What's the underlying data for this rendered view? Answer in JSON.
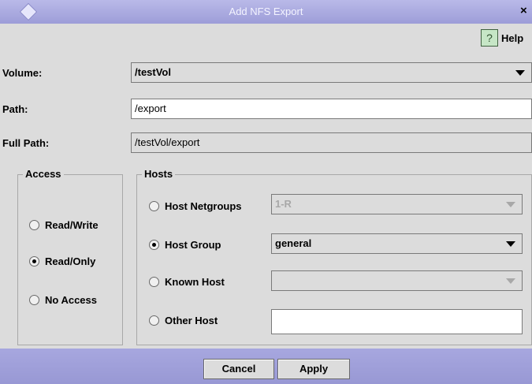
{
  "window": {
    "title": "Add NFS Export",
    "close_glyph": "×"
  },
  "toolbar": {
    "help_icon": "?",
    "help_label": "Help"
  },
  "form": {
    "volume": {
      "label": "Volume:",
      "value": "/testVol"
    },
    "path": {
      "label": "Path:",
      "value": "/export"
    },
    "full_path": {
      "label": "Full Path:",
      "value": "/testVol/export"
    }
  },
  "access": {
    "title": "Access",
    "options": [
      {
        "label": "Read/Write",
        "selected": false
      },
      {
        "label": "Read/Only",
        "selected": true
      },
      {
        "label": "No Access",
        "selected": false
      }
    ]
  },
  "hosts": {
    "title": "Hosts",
    "netgroups": {
      "label": "Host Netgroups",
      "value": "1-R",
      "selected": false,
      "enabled": false
    },
    "host_group": {
      "label": "Host Group",
      "value": "general",
      "selected": true,
      "enabled": true
    },
    "known_host": {
      "label": "Known Host",
      "value": "",
      "selected": false,
      "enabled": false
    },
    "other_host": {
      "label": "Other Host",
      "value": "",
      "selected": false
    }
  },
  "buttons": {
    "cancel": "Cancel",
    "apply": "Apply"
  },
  "colors": {
    "titlebar": "#a9a9e0",
    "background": "#dcdcdc",
    "footer": "#9e9ed8"
  }
}
